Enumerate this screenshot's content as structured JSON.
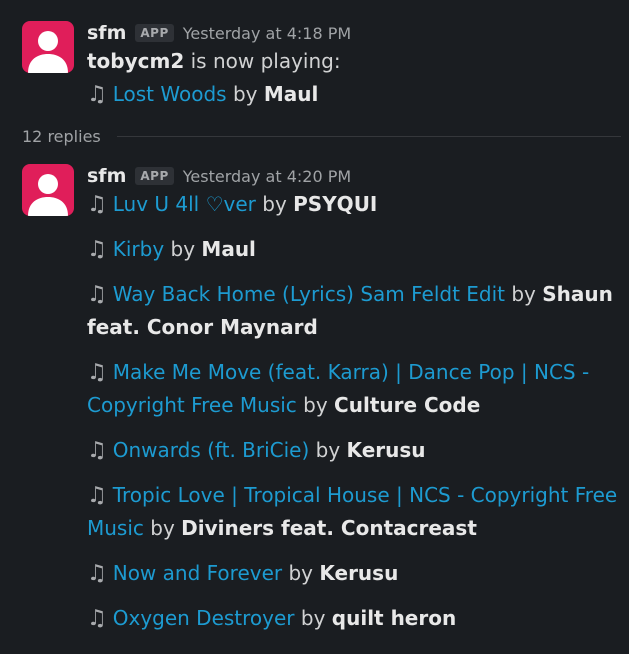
{
  "message1": {
    "author": "sfm",
    "badge": "APP",
    "time": "Yesterday at 4:18 PM",
    "now_playing": {
      "user": "tobycm2",
      "text": "is now playing:"
    },
    "song": {
      "icon": "musical-note-icon",
      "title": "Lost Woods",
      "by": "by",
      "artist": "Maul"
    }
  },
  "replies_label": "12 replies",
  "message2": {
    "author": "sfm",
    "badge": "APP",
    "time": "Yesterday at 4:20 PM",
    "songs": [
      {
        "title": "Luv U 4ll ♡ver",
        "by": "by",
        "artist": "PSYQUI"
      },
      {
        "title": "Kirby",
        "by": "by",
        "artist": "Maul"
      },
      {
        "title": "Way Back Home (Lyrics) Sam Feldt Edit",
        "by": "by",
        "artist": "Shaun feat. Conor Maynard"
      },
      {
        "title": "Make Me Move (feat. Karra) | Dance Pop | NCS - Copyright Free Music",
        "by": "by",
        "artist": "Culture Code"
      },
      {
        "title": "Onwards (ft. BriCie)",
        "by": "by",
        "artist": "Kerusu"
      },
      {
        "title": "Tropic Love | Tropical House | NCS - Copyright Free Music",
        "by": "by",
        "artist": "Diviners feat. Contacreast"
      },
      {
        "title": "Now and Forever",
        "by": "by",
        "artist": "Kerusu"
      },
      {
        "title": "Oxygen Destroyer",
        "by": "by",
        "artist": "quilt heron"
      }
    ]
  },
  "colors": {
    "background": "#1a1d21",
    "link": "#1d9bd1",
    "avatar": "#e01e5a"
  }
}
